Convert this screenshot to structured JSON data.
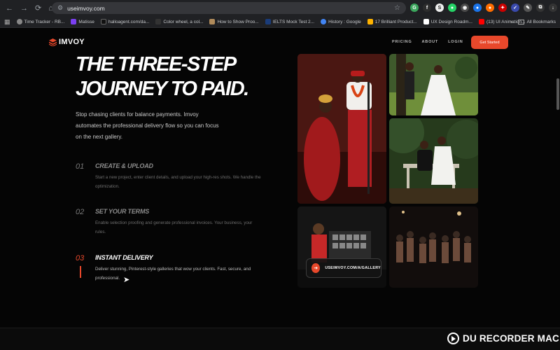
{
  "browser": {
    "url": "useimvoy.com",
    "bookmarks": [
      "Time Tracker - RB...",
      "Matisse",
      "halloagent.com/da...",
      "Color wheel, a col...",
      "How to Show Proo...",
      "IELTS Mock Test 2...",
      "History : Google",
      "17 Brilliant Product...",
      "UX Design Roadm...",
      "(13) UI Animation..."
    ],
    "all_bookmarks": "All Bookmarks"
  },
  "nav": {
    "logo": "IMVOY",
    "links": [
      "PRICING",
      "ABOUT",
      "LOGIN"
    ],
    "cta": "Get Started"
  },
  "hero": {
    "title_line1": "THE THREE-STEP",
    "title_line2": "JOURNEY TO PAID.",
    "subtitle": "Stop chasing clients for balance payments. Imvoy automates the professional delivery flow so you can focus on the next gallery."
  },
  "steps": [
    {
      "num": "01",
      "title": "CREATE & UPLOAD",
      "desc": "Start a new project, enter client details, and upload your high-res shots. We handle the optimization."
    },
    {
      "num": "02",
      "title": "SET YOUR TERMS",
      "desc": "Enable selection proofing and generate professional invoices. Your business, your rules."
    },
    {
      "num": "03",
      "title": "INSTANT DELIVERY",
      "desc": "Deliver stunning, Pinterest-style galleries that wow your clients. Fast, secure, and professional."
    }
  ],
  "gallery": {
    "link": "USEIMVOY.COM/A/GALLERY"
  },
  "watermark": "DU RECORDER MAC",
  "colors": {
    "accent": "#e8482b",
    "background": "#050505"
  }
}
